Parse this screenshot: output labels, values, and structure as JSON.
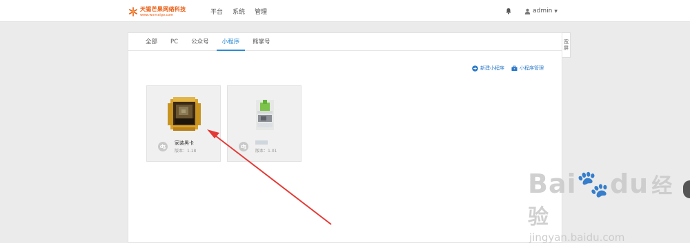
{
  "header": {
    "logo_name": "天锡芒果网络科技",
    "logo_url": "www.wxmaigo.com",
    "nav": [
      "平台",
      "系统",
      "管理"
    ],
    "user": "admin"
  },
  "tabs": [
    "全部",
    "PC",
    "公众号",
    "小程序",
    "熊掌号"
  ],
  "active_tab": "小程序",
  "actions": {
    "new_label": "新建小程序",
    "manage_label": "小程序管理"
  },
  "cards": [
    {
      "name": "家装黑卡",
      "version": "版本：1.18"
    },
    {
      "name": "",
      "version": "版本：1.01"
    }
  ],
  "side_button": [
    "宽",
    "屏"
  ],
  "watermark": {
    "logo": "Bai",
    "logo_tail": "du",
    "jingyan": "经验",
    "url": "jingyan.baidu.com"
  },
  "colors": {
    "accent": "#2a8ad6",
    "brand": "#e85c12",
    "arrow": "#e53935"
  }
}
